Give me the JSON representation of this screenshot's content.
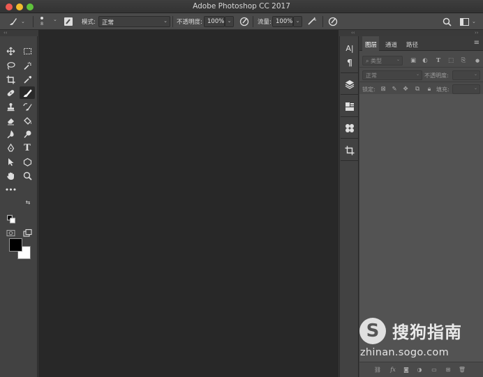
{
  "window": {
    "title": "Adobe Photoshop CC 2017"
  },
  "options_bar": {
    "brush_size": "8",
    "mode_label": "模式:",
    "mode_value": "正常",
    "opacity_label": "不透明度:",
    "opacity_value": "100%",
    "flow_label": "流量:",
    "flow_value": "100%"
  },
  "toolbar": {
    "active_tool": "brush-tool",
    "foreground_color": "#000000",
    "background_color": "#ffffff"
  },
  "layers_panel": {
    "tabs": [
      "图层",
      "通道",
      "路径"
    ],
    "active_tab": "图层",
    "filter_placeholder": "类型",
    "blend_mode": "正常",
    "opacity_label": "不透明度:",
    "lock_label": "锁定:",
    "fill_label": "填充:"
  },
  "watermark": {
    "logo": "S",
    "brand": "搜狗指南",
    "url": "zhinan.sogo.com"
  },
  "colors": {
    "canvas": "#282828",
    "panel": "#4a4a4a",
    "toolbar": "#424242"
  }
}
